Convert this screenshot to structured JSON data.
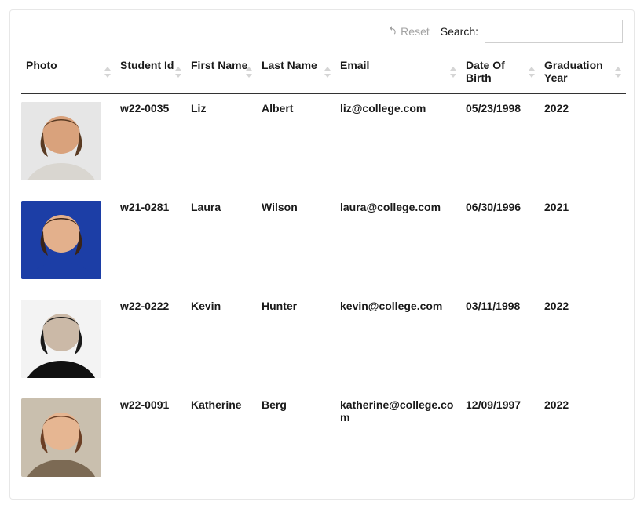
{
  "toolbar": {
    "reset_label": "Reset",
    "search_label": "Search:",
    "search_value": ""
  },
  "columns": {
    "photo": "Photo",
    "student_id": "Student Id",
    "first_name": "First Name",
    "last_name": "Last Name",
    "email": "Email",
    "dob": "Date Of Birth",
    "grad": "Graduation Year"
  },
  "rows": [
    {
      "student_id": "w22-0035",
      "first_name": "Liz",
      "last_name": "Albert",
      "email": "liz@college.com",
      "dob": "05/23/1998",
      "grad": "2022",
      "avatar_variant": "liz"
    },
    {
      "student_id": "w21-0281",
      "first_name": "Laura",
      "last_name": "Wilson",
      "email": "laura@college.com",
      "dob": "06/30/1996",
      "grad": "2021",
      "avatar_variant": "laura"
    },
    {
      "student_id": "w22-0222",
      "first_name": "Kevin",
      "last_name": "Hunter",
      "email": "kevin@college.com",
      "dob": "03/11/1998",
      "grad": "2022",
      "avatar_variant": "kevin"
    },
    {
      "student_id": "w22-0091",
      "first_name": "Katherine",
      "last_name": "Berg",
      "email": "katherine@college.com",
      "dob": "12/09/1997",
      "grad": "2022",
      "avatar_variant": "katherine"
    }
  ]
}
